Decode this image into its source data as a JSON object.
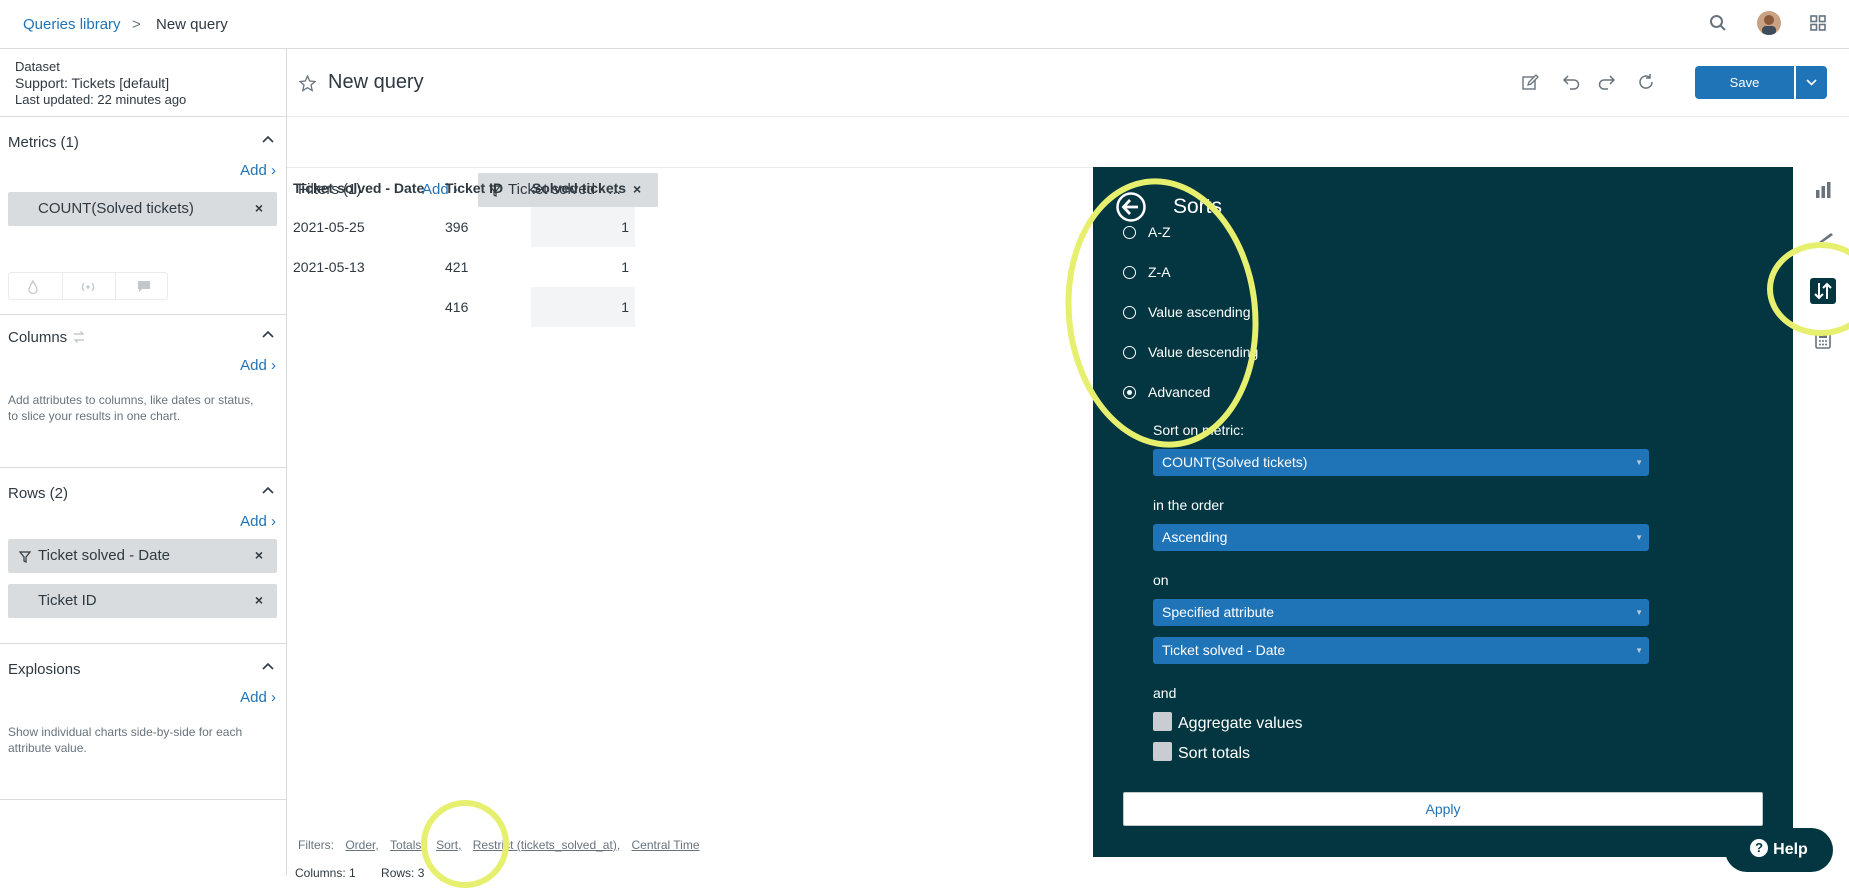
{
  "topbar": {
    "breadcrumb_link": "Queries library",
    "breadcrumb_sep": ">",
    "breadcrumb_current": "New query"
  },
  "sidebar": {
    "dataset_label": "Dataset",
    "dataset_name": "Support: Tickets [default]",
    "last_updated": "Last updated: 22 minutes ago",
    "metrics": {
      "title": "Metrics (1)",
      "add": "Add ›",
      "items": [
        "COUNT(Solved tickets)"
      ]
    },
    "columns": {
      "title": "Columns",
      "add": "Add ›",
      "hint": "Add attributes to columns, like dates or status, to slice your results in one chart."
    },
    "rows": {
      "title": "Rows (2)",
      "add": "Add ›",
      "items": [
        "Ticket solved - Date",
        "Ticket ID"
      ]
    },
    "explosions": {
      "title": "Explosions",
      "add": "Add ›",
      "hint": "Show individual charts side-by-side for each attribute value."
    },
    "remove_glyph": "×"
  },
  "main": {
    "query_title": "New query",
    "save_label": "Save",
    "filters": {
      "title": "Filters (1)",
      "add": "Add ›",
      "chip": "Ticket solved - ..."
    },
    "table": {
      "headers": [
        "Ticket solved - Date",
        "Ticket ID",
        "Solved tickets"
      ],
      "rows": [
        [
          "2021-05-25",
          "396",
          "1"
        ],
        [
          "2021-05-13",
          "421",
          "1"
        ],
        [
          "",
          "416",
          "1"
        ]
      ]
    },
    "footer": {
      "filters_label": "Filters:",
      "links": [
        "Order,",
        "Totals,",
        "Sort,",
        "Restrict (tickets_solved_at),",
        "Central Time"
      ],
      "columns_stat": "Columns: 1",
      "rows_stat": "Rows: 3"
    }
  },
  "sorts_panel": {
    "title": "Sorts",
    "options": [
      "A-Z",
      "Z-A",
      "Value ascending",
      "Value descending",
      "Advanced"
    ],
    "selected_option": "Advanced",
    "sort_on_metric_label": "Sort on metric:",
    "sort_on_metric_value": "COUNT(Solved tickets)",
    "order_label": "in the order",
    "order_value": "Ascending",
    "on_label": "on",
    "on_value": "Specified attribute",
    "attribute_value": "Ticket solved - Date",
    "and_label": "and",
    "aggregate_values_label": "Aggregate values",
    "sort_totals_label": "Sort totals",
    "apply_label": "Apply"
  },
  "help": {
    "label": "Help"
  },
  "colors": {
    "accent": "#1f73b7",
    "panel_bg": "#033640",
    "highlight": "#e6ef6e",
    "pill_bg": "#d8dcde"
  }
}
